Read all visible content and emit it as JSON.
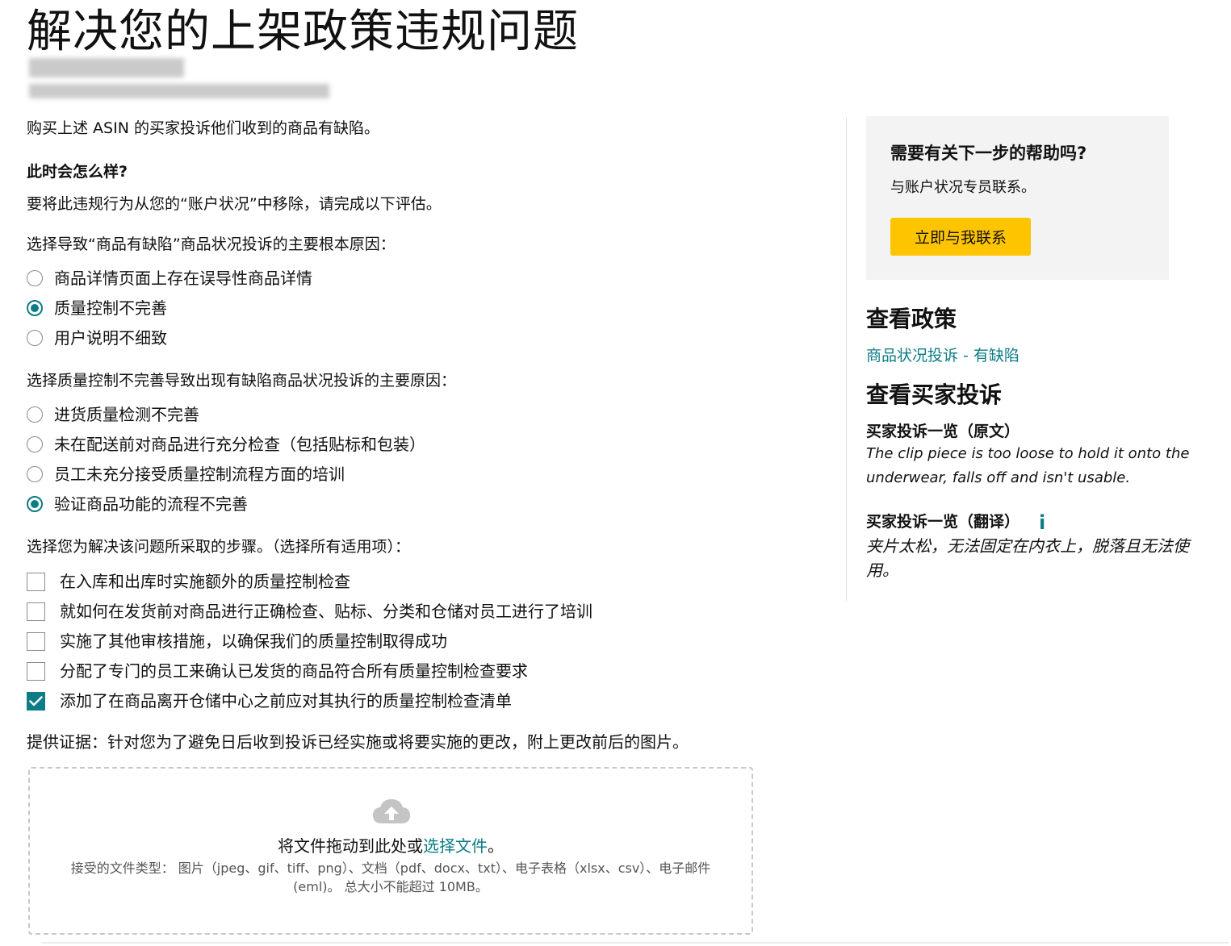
{
  "header": {
    "title": "解决您的上架政策违规问题"
  },
  "main": {
    "intro": "购买上述 ASIN 的买家投诉他们收到的商品有缺陷。",
    "what_happens_heading": "此时会怎么样?",
    "instruction": "要将此违规行为从您的“账户状况”中移除，请完成以下评估。",
    "question1": {
      "prompt": "选择导致“商品有缺陷”商品状况投诉的主要根本原因：",
      "options": [
        {
          "label": "商品详情页面上存在误导性商品详情",
          "selected": false
        },
        {
          "label": "质量控制不完善",
          "selected": true
        },
        {
          "label": "用户说明不细致",
          "selected": false
        }
      ]
    },
    "question2": {
      "prompt": "选择质量控制不完善导致出现有缺陷商品状况投诉的主要原因：",
      "options": [
        {
          "label": "进货质量检测不完善",
          "selected": false
        },
        {
          "label": "未在配送前对商品进行充分检查（包括贴标和包装）",
          "selected": false
        },
        {
          "label": "员工未充分接受质量控制流程方面的培训",
          "selected": false
        },
        {
          "label": "验证商品功能的流程不完善",
          "selected": true
        }
      ]
    },
    "question3": {
      "prompt": "选择您为解决该问题所采取的步骤。（选择所有适用项）：",
      "options": [
        {
          "label": "在入库和出库时实施额外的质量控制检查",
          "checked": false
        },
        {
          "label": "就如何在发货前对商品进行正确检查、贴标、分类和仓储对员工进行了培训",
          "checked": false
        },
        {
          "label": "实施了其他审核措施，以确保我们的质量控制取得成功",
          "checked": false
        },
        {
          "label": "分配了专门的员工来确认已发货的商品符合所有质量控制检查要求",
          "checked": false
        },
        {
          "label": "添加了在商品离开仓储中心之前应对其执行的质量控制检查清单",
          "checked": true
        }
      ]
    },
    "evidence": {
      "prompt": "提供证据：针对您为了避免日后收到投诉已经实施或将要实施的更改，附上更改前后的图片。",
      "drop_text": "将文件拖动到此处或",
      "drop_link": "选择文件",
      "drop_end": "。",
      "accepted_types": "接受的文件类型： 图片（jpeg、gif、tiff、png）、文档（pdf、docx、txt）、电子表格（xlsx、csv）、电子邮件 (eml)。 总大小不能超过 10MB。"
    }
  },
  "sidebar": {
    "help": {
      "title": "需要有关下一步的帮助吗?",
      "desc": "与账户状况专员联系。",
      "button": "立即与我联系"
    },
    "policy": {
      "heading": "查看政策",
      "link": "商品状况投诉 - 有缺陷"
    },
    "complaints": {
      "heading": "查看买家投诉",
      "original_heading": "买家投诉一览（原文）",
      "original_text": "The clip piece is too loose to hold it onto the underwear, falls off and isn't usable.",
      "translated_heading": "买家投诉一览（翻译）",
      "translated_text": "夹片太松，无法固定在内衣上，脱落且无法使用。"
    }
  },
  "icons": {
    "upload": "cloud-upload-icon",
    "info": "info-icon",
    "check": "checkmark-icon"
  },
  "colors": {
    "accent": "#0e7c86",
    "button": "#ffc400",
    "panel_bg": "#f3f3f3"
  }
}
